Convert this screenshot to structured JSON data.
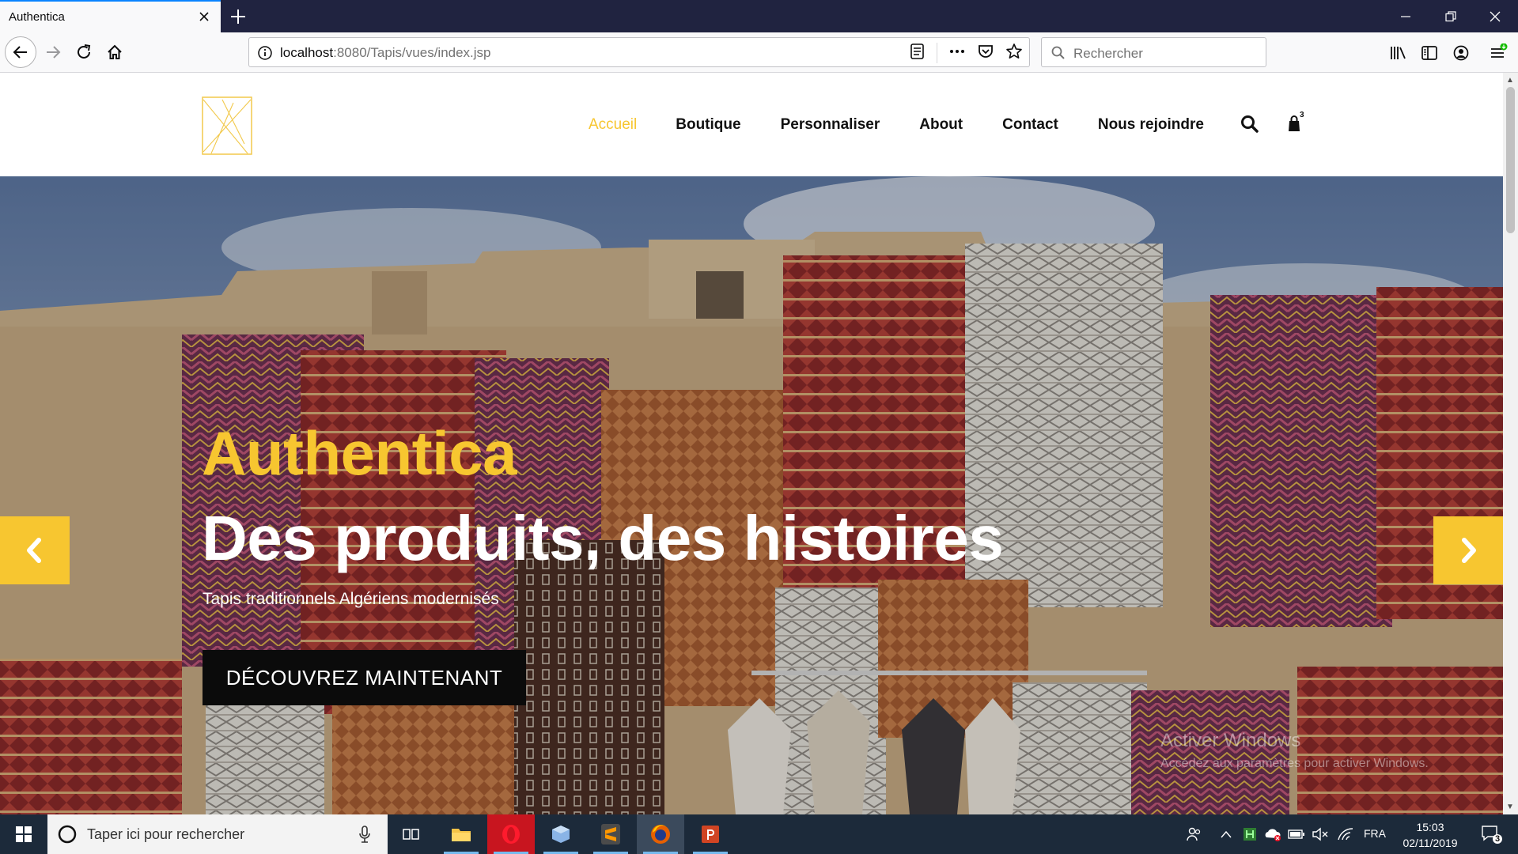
{
  "browser": {
    "tab_title": "Authentica",
    "url_host": "localhost",
    "url_rest": ":8080/Tapis/vues/index.jsp",
    "search_placeholder": "Rechercher"
  },
  "site": {
    "nav": [
      {
        "label": "Accueil",
        "active": true
      },
      {
        "label": "Boutique",
        "active": false
      },
      {
        "label": "Personnaliser",
        "active": false
      },
      {
        "label": "About",
        "active": false
      },
      {
        "label": "Contact",
        "active": false
      },
      {
        "label": "Nous rejoindre",
        "active": false
      }
    ],
    "cart_count": "3",
    "accent_color": "#f7c630"
  },
  "hero": {
    "brand": "Authentica",
    "title": "Des produits, des histoires",
    "subtitle": "Tapis traditionnels Algériens modernisés",
    "cta": "DÉCOUVREZ MAINTENANT"
  },
  "watermark": {
    "line1": "Activer Windows",
    "line2": "Accédez aux paramètres pour activer Windows."
  },
  "taskbar": {
    "search_placeholder": "Taper ici pour rechercher",
    "language": "FRA",
    "time": "15:03",
    "date": "02/11/2019",
    "notification_count": "3"
  }
}
